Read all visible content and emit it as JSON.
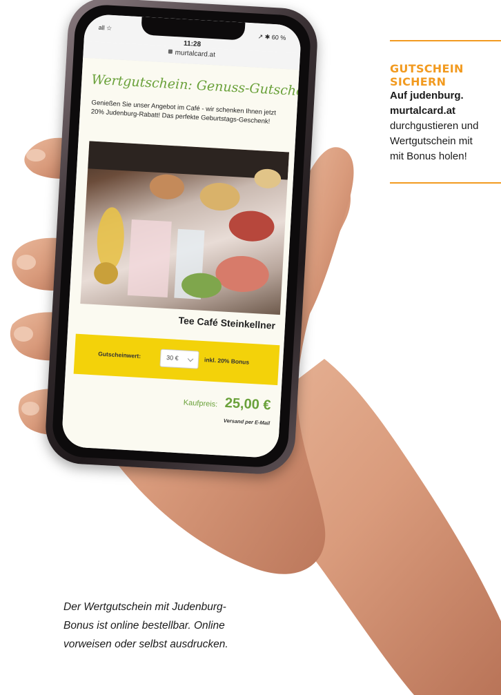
{
  "phone_screen": {
    "status_left": "all ☆",
    "status_time": "11:28",
    "status_right": "↗ ✱ 60 %",
    "url": "murtalcard.at",
    "voucher_title": "Wertgutschein: Genuss-Gutschein",
    "voucher_description": "Genießen Sie unser Angebot im Café - wir schenken Ihnen jetzt 20% Judenburg-Rabatt! Das perfekte Geburtstags-Geschenk!",
    "venue_name": "Tee Café Steinkellner",
    "voucher_label": "Gutscheinwert:",
    "voucher_select_value": "30 €",
    "voucher_bonus": "inkl. 20% Bonus",
    "price_label": "Kaufpreis:",
    "price_value": "25,00 €",
    "shipping": "Versand per E-Mail"
  },
  "info_box": {
    "heading_line1": "GUTSCHEIN",
    "heading_line2": "SICHERN",
    "line1": "Auf judenburg.",
    "line2": "murtalcard.at",
    "line3": "durchgustieren und",
    "line4": "Wertgutschein mit",
    "line5": "mit Bonus holen!"
  },
  "caption": {
    "line1": "Der Wertgutschein mit Judenburg-",
    "line2": "Bonus ist online bestellbar. Online",
    "line3": "vorweisen oder selbst ausdrucken."
  },
  "colors": {
    "accent_orange": "#f29a1f",
    "voucher_green": "#6aa13a",
    "voucher_yellow": "#f3d20a"
  }
}
